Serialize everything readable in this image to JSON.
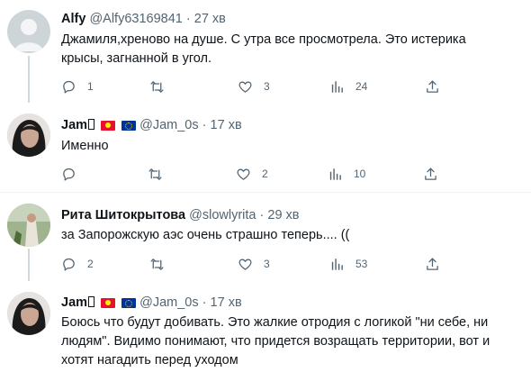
{
  "tweets": [
    {
      "name": "Alfy",
      "handle": "@Alfy63169841",
      "time": "27 хв",
      "text": "Джамиля,хреново на душе. С утра все просмотрела. Это истерика крысы, загнанной в угол.",
      "replies": "1",
      "retweets": "",
      "likes": "3",
      "views": "24"
    },
    {
      "name": "Jam",
      "handle": "@Jam_0s",
      "time": "17 хв",
      "text": "Именно",
      "replies": "",
      "retweets": "",
      "likes": "2",
      "views": "10"
    },
    {
      "name": "Рита Шитокрытова",
      "handle": "@slowlyrita",
      "time": "29 хв",
      "text": "за Запорожскую аэс очень страшно теперь.... ((",
      "replies": "2",
      "retweets": "",
      "likes": "3",
      "views": "53"
    },
    {
      "name": "Jam",
      "handle": "@Jam_0s",
      "time": "17 хв",
      "text": "Боюсь что будут добивать. Это жалкие отродия с логикой \"ни себе, ни людям\". Видимо понимают, что придется возращать территории, вот и хотят нагадить перед уходом",
      "replies": "",
      "retweets": "",
      "likes": "",
      "views": ""
    }
  ],
  "separator": "·",
  "colors": {
    "text": "#0f1419",
    "secondary": "#536471",
    "thread_line": "#cfd9de",
    "divider": "#eff3f4"
  },
  "icons": [
    "reply-icon",
    "retweet-icon",
    "like-icon",
    "views-icon",
    "share-icon"
  ]
}
